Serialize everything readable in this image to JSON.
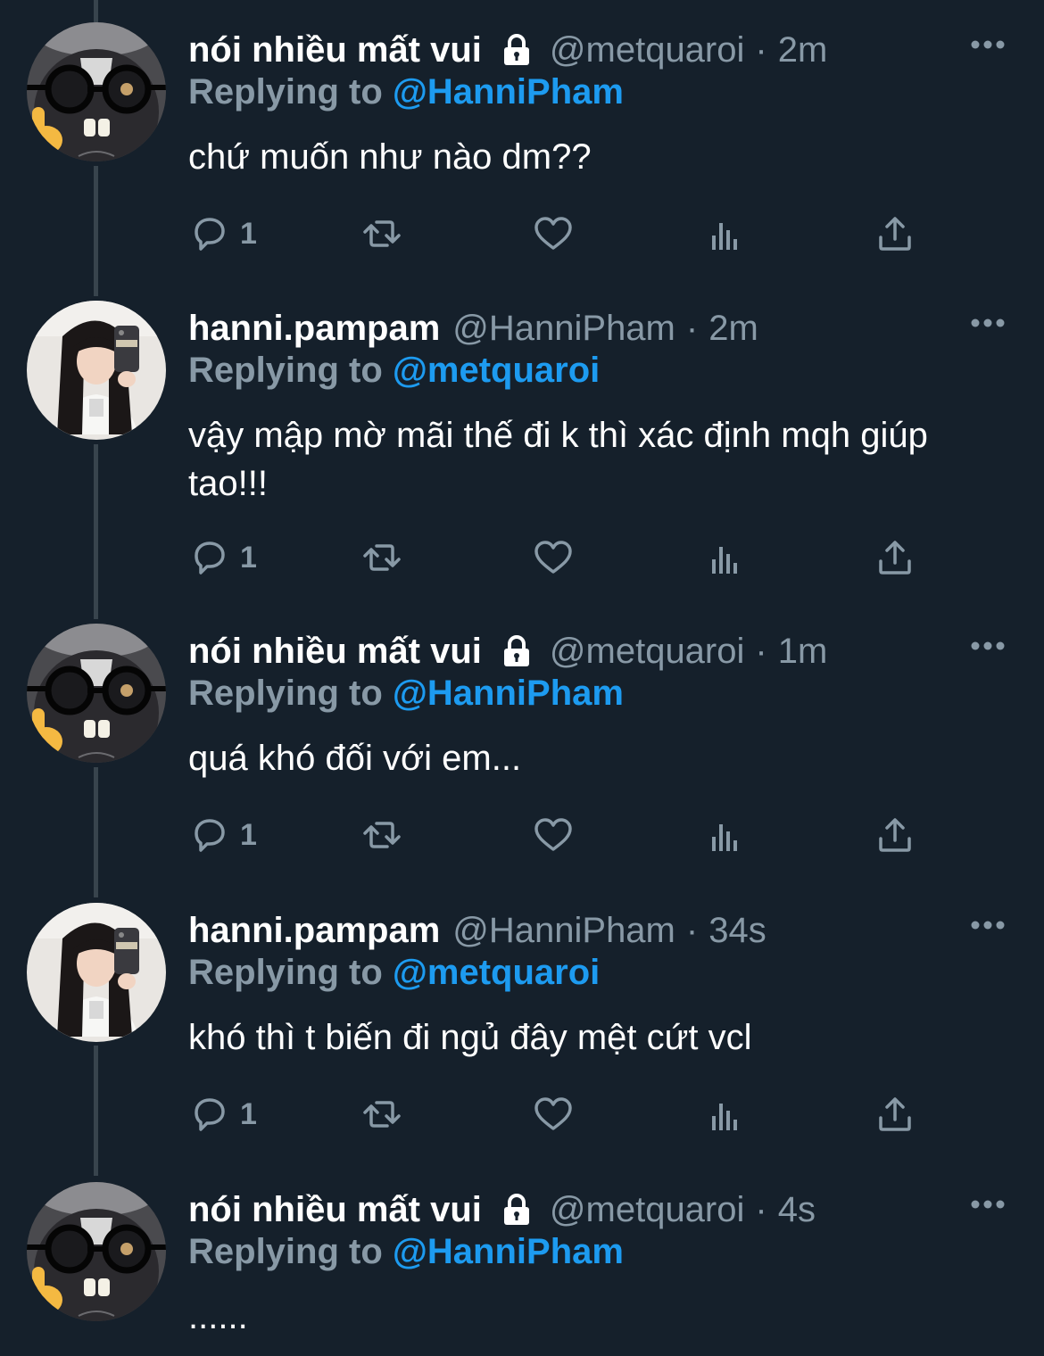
{
  "colors": {
    "background": "#15202b",
    "muted": "#8899a6",
    "link": "#1d9bf0",
    "thread_line": "#38444d"
  },
  "icons": {
    "lock": "lock-icon",
    "more": "more-horizontal-icon",
    "reply": "reply-bubble-icon",
    "retweet": "retweet-icon",
    "like": "heart-icon",
    "views": "bar-chart-icon",
    "share": "share-upload-icon"
  },
  "tweets": [
    {
      "display_name": "nói nhiều mất vui",
      "handle": "@metquaroi",
      "dot": "·",
      "time": "2m",
      "replying_prefix": "Replying to",
      "replying_to": "@HanniPham",
      "text": "chứ muốn như nào dm??",
      "reply_count": "1"
    },
    {
      "display_name": "hanni.pampam",
      "handle": "@HanniPham",
      "dot": "·",
      "time": "2m",
      "replying_prefix": "Replying to",
      "replying_to": "@metquaroi",
      "text": "vậy mập mờ mãi thế đi k thì xác định mqh giúp tao!!!",
      "reply_count": "1"
    },
    {
      "display_name": "nói nhiều mất vui",
      "handle": "@metquaroi",
      "dot": "·",
      "time": "1m",
      "replying_prefix": "Replying to",
      "replying_to": "@HanniPham",
      "text": "quá khó đối với em...",
      "reply_count": "1"
    },
    {
      "display_name": "hanni.pampam",
      "handle": "@HanniPham",
      "dot": "·",
      "time": "34s",
      "replying_prefix": "Replying to",
      "replying_to": "@metquaroi",
      "text": "khó thì t biến đi ngủ đây mệt cứt vcl",
      "reply_count": "1"
    },
    {
      "display_name": "nói nhiều mất vui",
      "handle": "@metquaroi",
      "dot": "·",
      "time": "4s",
      "replying_prefix": "Replying to",
      "replying_to": "@HanniPham",
      "text": "......"
    }
  ]
}
